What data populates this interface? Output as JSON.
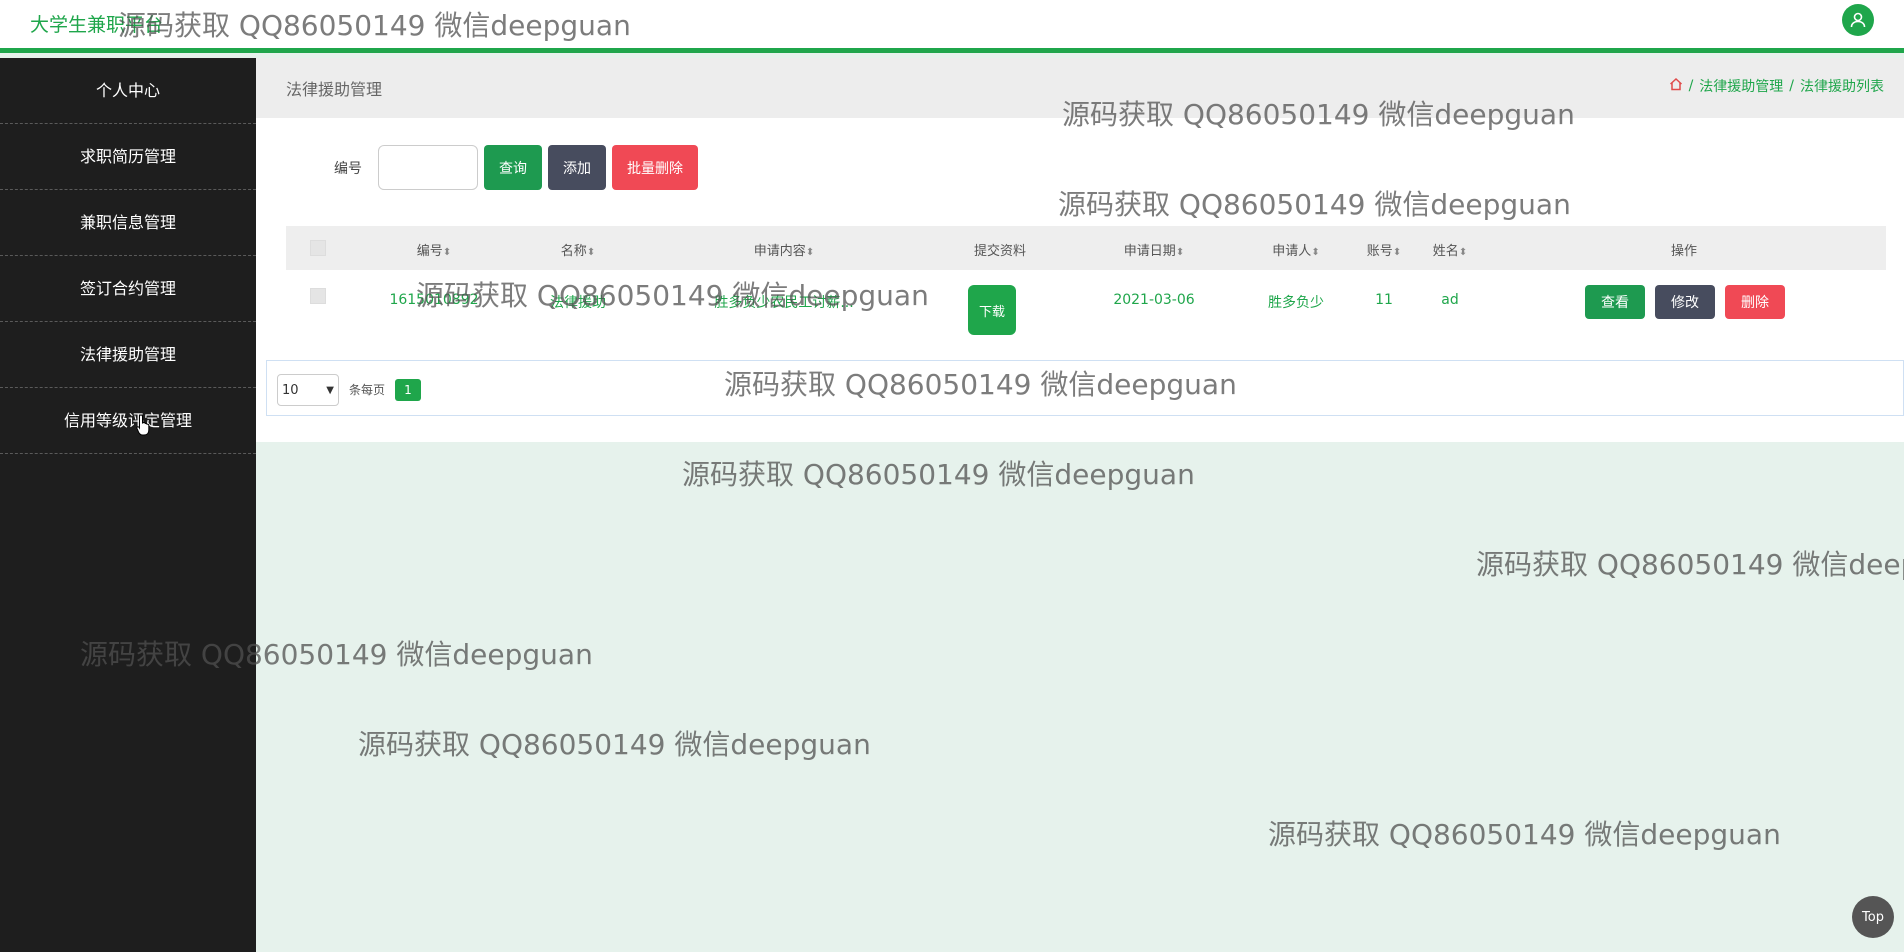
{
  "header": {
    "app_title": "大学生兼职平台",
    "user_icon": "user-icon"
  },
  "sidebar": {
    "items": [
      {
        "label": "个人中心"
      },
      {
        "label": "求职简历管理"
      },
      {
        "label": "兼职信息管理"
      },
      {
        "label": "签订合约管理"
      },
      {
        "label": "法律援助管理"
      },
      {
        "label": "信用等级评定管理"
      }
    ]
  },
  "breadcrumb": {
    "section_title": "法律援助管理",
    "home_icon": "home-icon",
    "crumb1": "法律援助管理",
    "crumb2": "法律援助列表"
  },
  "search": {
    "label": "编号",
    "value": "",
    "query_button": "查询",
    "add_button": "添加",
    "batch_delete_button": "批量删除"
  },
  "table": {
    "headers": {
      "number": "编号",
      "name": "名称",
      "content": "申请内容",
      "files": "提交资料",
      "date": "申请日期",
      "applicant": "申请人",
      "account": "账号",
      "realname": "姓名",
      "actions": "操作"
    },
    "rows": [
      {
        "number": "1615010892",
        "name": "法律援助",
        "content": "胜多负少农民工讨薪...",
        "download": "下载",
        "date": "2021-03-06",
        "applicant": "胜多负少",
        "account": "11",
        "realname": "ad",
        "view": "查看",
        "edit": "修改",
        "delete": "删除"
      }
    ]
  },
  "pager": {
    "page_size": "10",
    "page_size_label": "条每页",
    "current_page": "1"
  },
  "watermark": "源码获取 QQ86050149 微信deepguan",
  "top_button": "Top",
  "colors": {
    "accent": "#1fa64b",
    "sidebar_bg": "#1e1e1e",
    "danger": "#f04955",
    "secondary": "#474c5e",
    "content_bg": "#e6f2ec"
  }
}
